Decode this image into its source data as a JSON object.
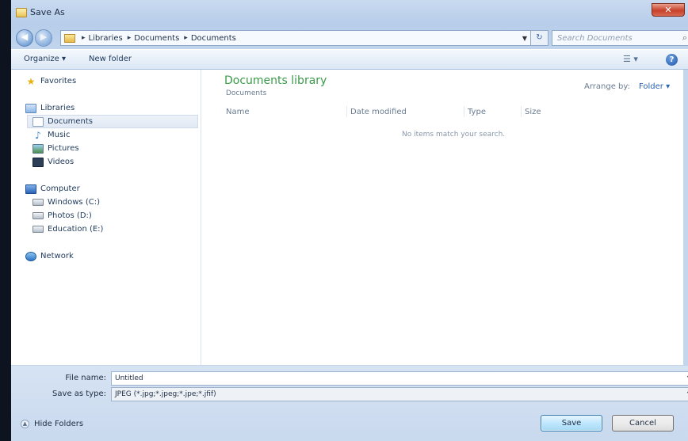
{
  "window": {
    "title": "Save As",
    "close_glyph": "✕"
  },
  "address": {
    "crumbs": [
      "Libraries",
      "Documents",
      "Documents"
    ],
    "search_placeholder": "Search Documents"
  },
  "toolbar": {
    "organize": "Organize ▾",
    "new_folder": "New folder"
  },
  "nav": {
    "favorites": "Favorites",
    "libraries": "Libraries",
    "documents": "Documents",
    "music": "Music",
    "pictures": "Pictures",
    "videos": "Videos",
    "computer": "Computer",
    "windows_c": "Windows (C:)",
    "photos_d": "Photos (D:)",
    "education_e": "Education (E:)",
    "network": "Network"
  },
  "library": {
    "title": "Documents library",
    "subtitle": "Documents",
    "arrange_label": "Arrange by:",
    "arrange_value": "Folder ▾"
  },
  "columns": [
    "Name",
    "Date modified",
    "Type",
    "Size"
  ],
  "empty_message": "No items match your search.",
  "form": {
    "file_name_label": "File name:",
    "file_name_value": "Untitled",
    "type_label": "Save as type:",
    "type_value": "JPEG (*.jpg;*.jpeg;*.jpe;*.jfif)"
  },
  "footer": {
    "hide_folders": "Hide Folders",
    "save": "Save",
    "cancel": "Cancel"
  },
  "colors": {
    "library_title": "#3b9a4a",
    "link": "#2a63b2",
    "close": "#c7402a"
  }
}
